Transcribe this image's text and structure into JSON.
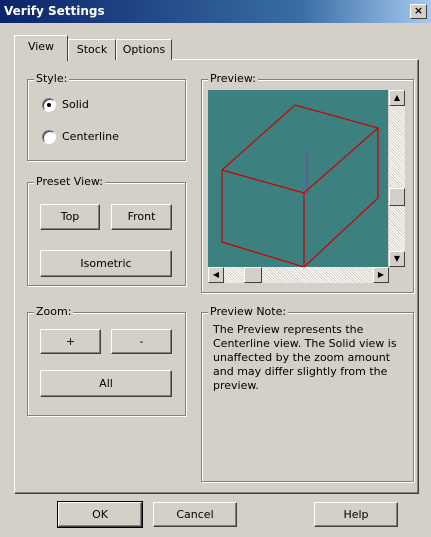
{
  "window": {
    "title": "Verify Settings",
    "close_label": "×"
  },
  "tabs": [
    {
      "label": "View",
      "active": true
    },
    {
      "label": "Stock",
      "active": false
    },
    {
      "label": "Options",
      "active": false
    }
  ],
  "style_group": {
    "label": "Style:",
    "options": [
      {
        "label": "Solid",
        "selected": true
      },
      {
        "label": "Centerline",
        "selected": false
      }
    ]
  },
  "preset_view": {
    "label": "Preset View:",
    "top_label": "Top",
    "front_label": "Front",
    "isometric_label": "Isometric"
  },
  "zoom": {
    "label": "Zoom:",
    "plus_label": "+",
    "minus_label": "-",
    "all_label": "All"
  },
  "preview": {
    "label": "Preview:",
    "background": "#3d8080",
    "box_color": "#cc0000",
    "axis_color": "#7a3fb0"
  },
  "preview_note": {
    "label": "Preview Note:",
    "text": "The Preview represents the Centerline view.  The Solid view is unaffected by the zoom amount and may differ slightly from the preview."
  },
  "footer": {
    "ok_label": "OK",
    "cancel_label": "Cancel",
    "help_label": "Help"
  }
}
